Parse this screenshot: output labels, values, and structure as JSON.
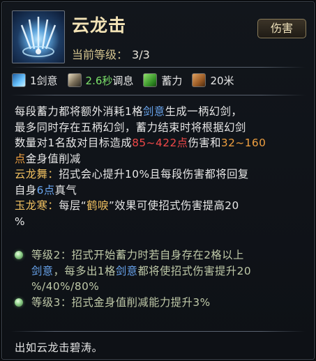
{
  "skill": {
    "name": "云龙击",
    "level_label": "当前等级：",
    "level_value": "3/3",
    "tag": "伤害",
    "icon": "skill-sword-icon"
  },
  "stats": [
    {
      "icon": "sword-intent-icon",
      "text": "1剑意",
      "color": "#e6e6e6"
    },
    {
      "icon": "cooldown-icon",
      "text": "2.6秒",
      "suffix": "调息",
      "color": "#7ce26a"
    },
    {
      "icon": "charge-icon",
      "text": "蓄力",
      "color": "#e6e6e6"
    },
    {
      "icon": "range-icon",
      "text": "20米",
      "color": "#e6e6e6"
    }
  ],
  "description": {
    "p1_a": "每段蓄力都将额外消耗1格",
    "p1_b": "剑意",
    "p1_c": "生成一柄幻剑，",
    "p1_line2": "最多同时存在五柄幻剑，蓄力结束时将根据幻剑",
    "p1_line3_a": "数量对1名敌对目标造成",
    "p1_dmg_min": "85",
    "p1_tilde": "~",
    "p1_dmg_max": "422点",
    "p1_line3_b": "伤害和",
    "p1_poise_min": "32",
    "p1_tilde2": "~",
    "p1_poise_max": "160",
    "p1_line4_a": "点",
    "p1_line4_b": "金身值削减",
    "p2_title": "云龙舞：",
    "p2_text": "招式会心提升10%且每段伤害都将回复",
    "p2_line2_a": "自身",
    "p2_line2_b": "6点",
    "p2_line2_c": "真气",
    "p3_title": "玉龙寒：",
    "p3_text": "每层“",
    "p3_keyword": "鹤唳",
    "p3_text2": "”效果可使招式伤害提高20",
    "p3_line2": "%"
  },
  "levels": [
    {
      "label": "等级2：",
      "text_a": "招式开始蓄力时若自身存在2格以上",
      "text_b": "剑意",
      "text_c": "，每多出1格",
      "text_d": "剑意",
      "text_e": "都将使招式伤害提升20",
      "text_f": "%/40%/80%"
    },
    {
      "label": "等级3：",
      "text_a": "招式金身值削减能力提升3%"
    }
  ],
  "flavor": "出如云龙击碧涛。",
  "colors": {
    "title": "#f3e3b6",
    "keyword_blue": "#6aa6f0",
    "damage_red": "#f04848",
    "poise_orange": "#f0a040",
    "cooldown_green": "#7ce26a"
  }
}
